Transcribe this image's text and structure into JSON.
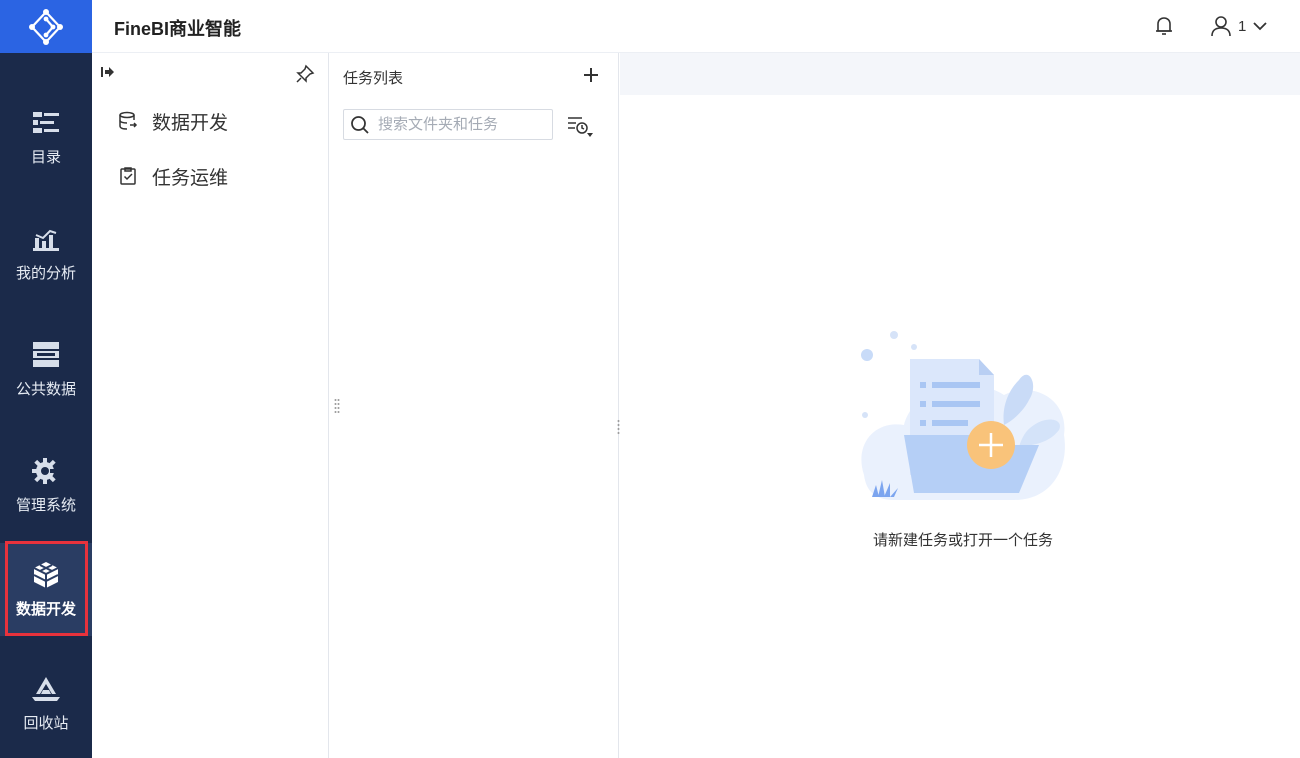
{
  "app": {
    "title": "FineBI商业智能"
  },
  "header": {
    "user_name": "1"
  },
  "rail": {
    "items": [
      {
        "label": "目录"
      },
      {
        "label": "我的分析"
      },
      {
        "label": "公共数据"
      },
      {
        "label": "管理系统"
      },
      {
        "label": "数据开发"
      },
      {
        "label": "回收站"
      }
    ],
    "active_index": 4,
    "colors": {
      "background": "#1b2a4a",
      "logo_bg": "#2b64e3",
      "highlight_border": "#e8323c"
    }
  },
  "subnav": {
    "items": [
      {
        "label": "数据开发",
        "icon": "database-icon"
      },
      {
        "label": "任务运维",
        "icon": "clipboard-check-icon"
      }
    ]
  },
  "tasklist": {
    "header": "任务列表",
    "search_placeholder": "搜索文件夹和任务"
  },
  "main": {
    "empty_message": "请新建任务或打开一个任务"
  }
}
